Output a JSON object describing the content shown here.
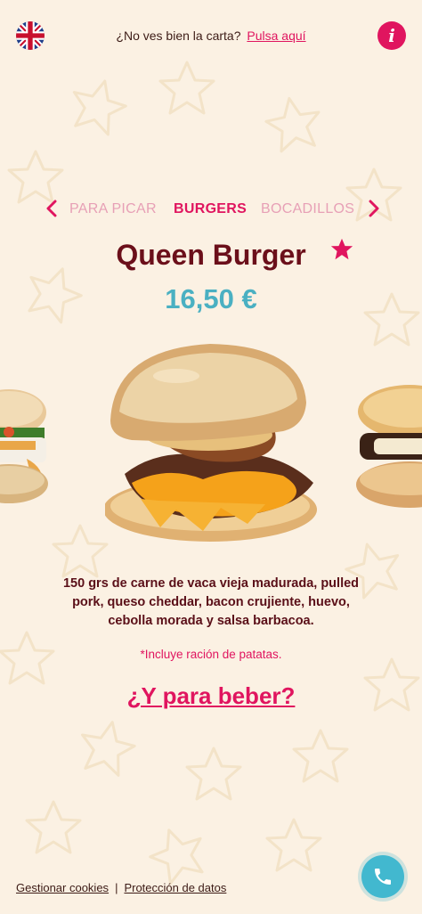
{
  "header": {
    "language_icon": "uk-flag-icon",
    "message": "¿No ves bien la carta?",
    "link_label": "Pulsa aquí",
    "info_icon": "info-icon"
  },
  "categories": {
    "items": [
      {
        "label": "PARA PICAR",
        "active": false
      },
      {
        "label": "BURGERS",
        "active": true
      },
      {
        "label": "BOCADILLOS",
        "active": false
      }
    ],
    "prev_icon": "chevron-left-icon",
    "next_icon": "chevron-right-icon"
  },
  "product": {
    "name": "Queen Burger",
    "featured_icon": "star-icon",
    "price": "16,50 €",
    "description": "150 grs de carne de vaca vieja madurada, pulled pork, queso  cheddar, bacon crujiente, huevo,  cebolla morada y salsa barbacoa.",
    "note": "*Incluye ración de patatas."
  },
  "drinks_link": "¿Y para beber?",
  "footer": {
    "cookies": "Gestionar cookies",
    "separator": "|",
    "privacy": "Protección de datos"
  },
  "phone_icon": "phone-icon",
  "colors": {
    "background": "#fbf1e3",
    "accent": "#e0155f",
    "title": "#6b0f1a",
    "price": "#4ab0c2"
  }
}
